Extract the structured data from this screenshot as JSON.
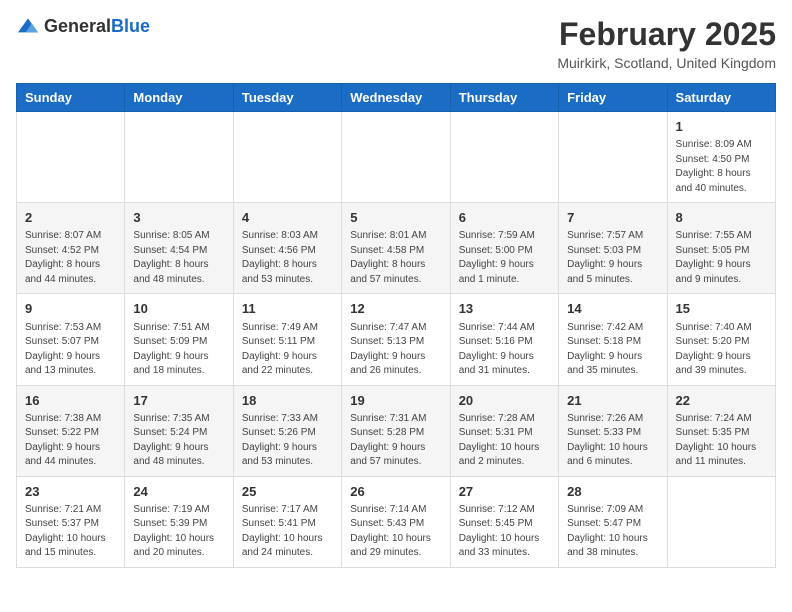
{
  "header": {
    "logo_general": "General",
    "logo_blue": "Blue",
    "month_title": "February 2025",
    "location": "Muirkirk, Scotland, United Kingdom"
  },
  "weekdays": [
    "Sunday",
    "Monday",
    "Tuesday",
    "Wednesday",
    "Thursday",
    "Friday",
    "Saturday"
  ],
  "weeks": [
    [
      {
        "day": "",
        "info": ""
      },
      {
        "day": "",
        "info": ""
      },
      {
        "day": "",
        "info": ""
      },
      {
        "day": "",
        "info": ""
      },
      {
        "day": "",
        "info": ""
      },
      {
        "day": "",
        "info": ""
      },
      {
        "day": "1",
        "info": "Sunrise: 8:09 AM\nSunset: 4:50 PM\nDaylight: 8 hours and 40 minutes."
      }
    ],
    [
      {
        "day": "2",
        "info": "Sunrise: 8:07 AM\nSunset: 4:52 PM\nDaylight: 8 hours and 44 minutes."
      },
      {
        "day": "3",
        "info": "Sunrise: 8:05 AM\nSunset: 4:54 PM\nDaylight: 8 hours and 48 minutes."
      },
      {
        "day": "4",
        "info": "Sunrise: 8:03 AM\nSunset: 4:56 PM\nDaylight: 8 hours and 53 minutes."
      },
      {
        "day": "5",
        "info": "Sunrise: 8:01 AM\nSunset: 4:58 PM\nDaylight: 8 hours and 57 minutes."
      },
      {
        "day": "6",
        "info": "Sunrise: 7:59 AM\nSunset: 5:00 PM\nDaylight: 9 hours and 1 minute."
      },
      {
        "day": "7",
        "info": "Sunrise: 7:57 AM\nSunset: 5:03 PM\nDaylight: 9 hours and 5 minutes."
      },
      {
        "day": "8",
        "info": "Sunrise: 7:55 AM\nSunset: 5:05 PM\nDaylight: 9 hours and 9 minutes."
      }
    ],
    [
      {
        "day": "9",
        "info": "Sunrise: 7:53 AM\nSunset: 5:07 PM\nDaylight: 9 hours and 13 minutes."
      },
      {
        "day": "10",
        "info": "Sunrise: 7:51 AM\nSunset: 5:09 PM\nDaylight: 9 hours and 18 minutes."
      },
      {
        "day": "11",
        "info": "Sunrise: 7:49 AM\nSunset: 5:11 PM\nDaylight: 9 hours and 22 minutes."
      },
      {
        "day": "12",
        "info": "Sunrise: 7:47 AM\nSunset: 5:13 PM\nDaylight: 9 hours and 26 minutes."
      },
      {
        "day": "13",
        "info": "Sunrise: 7:44 AM\nSunset: 5:16 PM\nDaylight: 9 hours and 31 minutes."
      },
      {
        "day": "14",
        "info": "Sunrise: 7:42 AM\nSunset: 5:18 PM\nDaylight: 9 hours and 35 minutes."
      },
      {
        "day": "15",
        "info": "Sunrise: 7:40 AM\nSunset: 5:20 PM\nDaylight: 9 hours and 39 minutes."
      }
    ],
    [
      {
        "day": "16",
        "info": "Sunrise: 7:38 AM\nSunset: 5:22 PM\nDaylight: 9 hours and 44 minutes."
      },
      {
        "day": "17",
        "info": "Sunrise: 7:35 AM\nSunset: 5:24 PM\nDaylight: 9 hours and 48 minutes."
      },
      {
        "day": "18",
        "info": "Sunrise: 7:33 AM\nSunset: 5:26 PM\nDaylight: 9 hours and 53 minutes."
      },
      {
        "day": "19",
        "info": "Sunrise: 7:31 AM\nSunset: 5:28 PM\nDaylight: 9 hours and 57 minutes."
      },
      {
        "day": "20",
        "info": "Sunrise: 7:28 AM\nSunset: 5:31 PM\nDaylight: 10 hours and 2 minutes."
      },
      {
        "day": "21",
        "info": "Sunrise: 7:26 AM\nSunset: 5:33 PM\nDaylight: 10 hours and 6 minutes."
      },
      {
        "day": "22",
        "info": "Sunrise: 7:24 AM\nSunset: 5:35 PM\nDaylight: 10 hours and 11 minutes."
      }
    ],
    [
      {
        "day": "23",
        "info": "Sunrise: 7:21 AM\nSunset: 5:37 PM\nDaylight: 10 hours and 15 minutes."
      },
      {
        "day": "24",
        "info": "Sunrise: 7:19 AM\nSunset: 5:39 PM\nDaylight: 10 hours and 20 minutes."
      },
      {
        "day": "25",
        "info": "Sunrise: 7:17 AM\nSunset: 5:41 PM\nDaylight: 10 hours and 24 minutes."
      },
      {
        "day": "26",
        "info": "Sunrise: 7:14 AM\nSunset: 5:43 PM\nDaylight: 10 hours and 29 minutes."
      },
      {
        "day": "27",
        "info": "Sunrise: 7:12 AM\nSunset: 5:45 PM\nDaylight: 10 hours and 33 minutes."
      },
      {
        "day": "28",
        "info": "Sunrise: 7:09 AM\nSunset: 5:47 PM\nDaylight: 10 hours and 38 minutes."
      },
      {
        "day": "",
        "info": ""
      }
    ]
  ]
}
